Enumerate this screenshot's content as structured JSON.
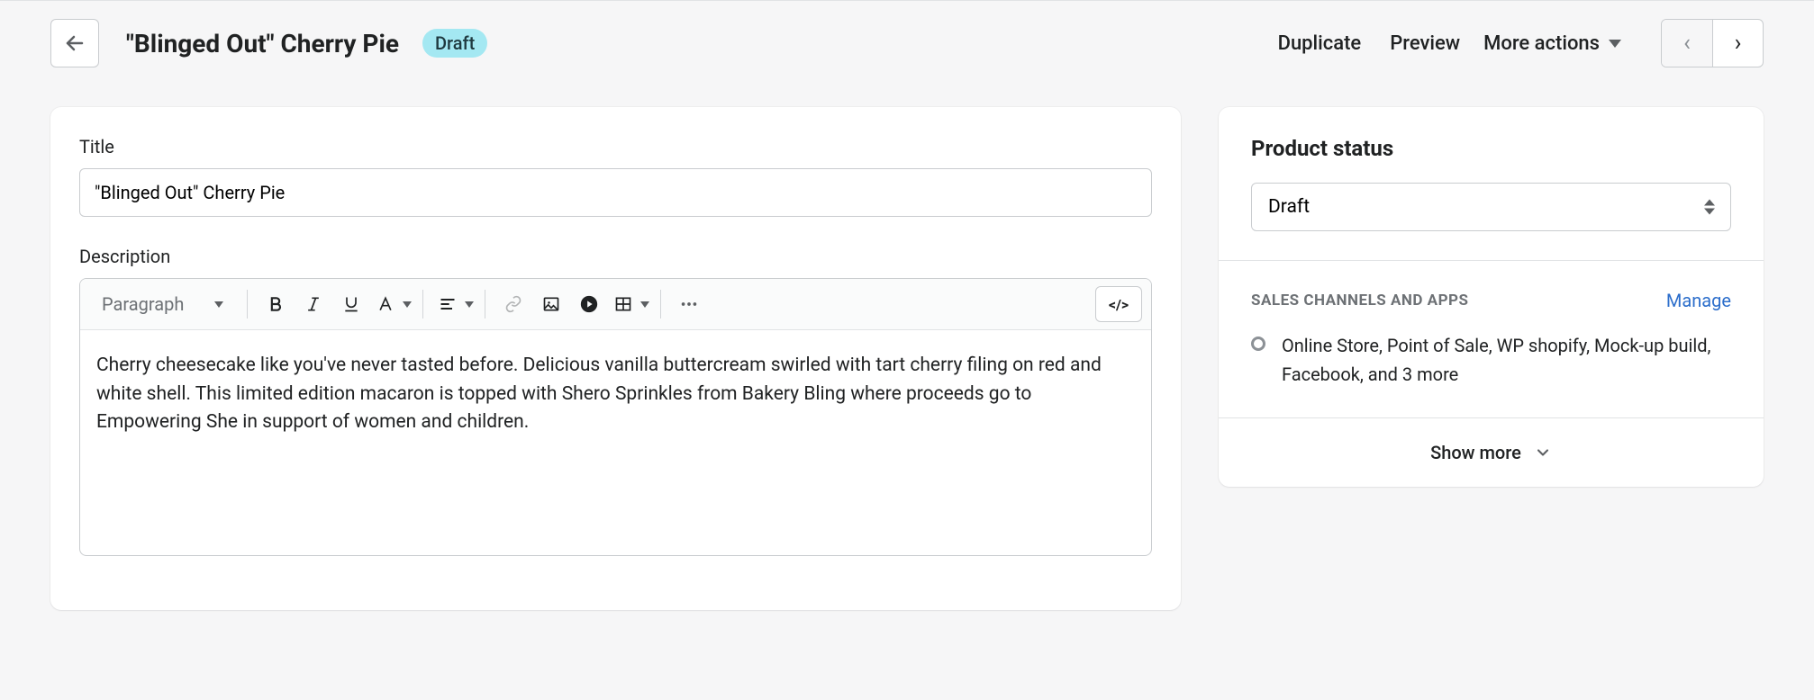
{
  "header": {
    "title": "\"Blinged Out\" Cherry Pie",
    "badge": "Draft",
    "actions": {
      "duplicate": "Duplicate",
      "preview": "Preview",
      "more": "More actions"
    }
  },
  "main": {
    "title_label": "Title",
    "title_value": "\"Blinged Out\" Cherry Pie",
    "description_label": "Description",
    "format_label": "Paragraph",
    "description_body": "Cherry cheesecake like you've never tasted before. Delicious vanilla buttercream swirled with tart cherry filing on red and white shell. This limited edition macaron is topped with Shero Sprinkles from Bakery Bling where proceeds go to Empowering She in support of women and children."
  },
  "sidebar": {
    "status_title": "Product status",
    "status_value": "Draft",
    "channels_title": "SALES CHANNELS AND APPS",
    "manage_label": "Manage",
    "channels_text": "Online Store, Point of Sale, WP shopify, Mock-up build, Facebook, and 3 more",
    "show_more": "Show more"
  }
}
